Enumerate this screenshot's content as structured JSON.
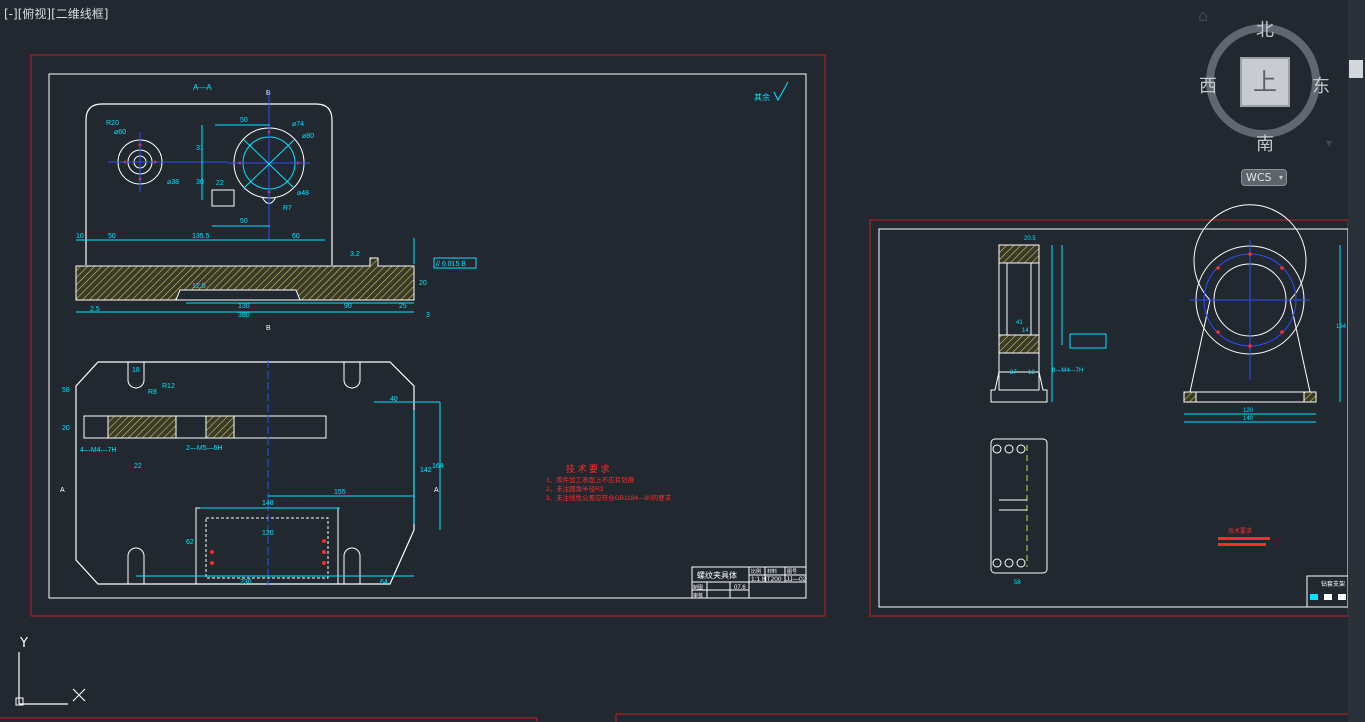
{
  "viewport_label": {
    "minus": "[-]",
    "view": "[俯视]",
    "style": "[二维线框]"
  },
  "viewcube": {
    "top_face": "上",
    "north": "北",
    "south": "南",
    "east": "东",
    "west": "西",
    "wcs": "WCS"
  },
  "ucs": {
    "y": "Y"
  },
  "colors": {
    "background": "#212830",
    "frame": "#c41e1e",
    "border": "#ffffff",
    "dim": "#00e5ff",
    "hatch": "#c9c85a",
    "text_red": "#ff2a2a",
    "center": "#2f4bff"
  },
  "sheet1": {
    "section_label": "A—A",
    "marker_b": "B",
    "marker_a": "A",
    "roughness_other": "其余",
    "dim_r20": "R20",
    "dim_phi60": "⌀60",
    "dim_phi38": "⌀38",
    "dim_50_top": "50",
    "dim_phi74": "⌀74",
    "dim_phi80": "⌀80",
    "dim_phi48": "⌀48",
    "dim_r7": "R7",
    "dim_31": "31",
    "dim_30": "30",
    "dim_22": "22",
    "dim_50_mid": "50",
    "dim_10": "10",
    "dim_50_left": "50",
    "dim_135": "135.5",
    "dim_60": "60",
    "dim_12_5": "12.5",
    "dim_130": "130",
    "dim_90": "90",
    "dim_25": "25",
    "dim_380": "380",
    "dim_3": "3",
    "dim_2_5": "2.5",
    "dim_20": "20",
    "roughness_32": "3.2",
    "tolerance": "// 0.015 B",
    "dim_58": "58",
    "dim_18": "18",
    "dim_r12": "R12",
    "dim_r8": "R8",
    "dim_40": "40",
    "dim_20_left": "20",
    "thread_m4": "4—M4—7H",
    "thread_m5": "2—M5—6H",
    "dim_22_b": "22",
    "dim_142": "142",
    "dim_164": "164",
    "dim_155": "155",
    "dim_148": "148",
    "dim_120": "120",
    "dim_62": "62",
    "dim_230": "230",
    "dim_64": "64",
    "tech_title": "技 术 要 求",
    "tech_1": "1、零件加工表面上不应有划痕",
    "tech_2": "2、未注圆角半径R3",
    "tech_3": "3、未注线性公差应符合GB1184—80的要求",
    "title_name": "螺纹夹具体",
    "title_scale": "比例",
    "title_material": "材料",
    "title_number": "图号",
    "title_scale_val": "1:1",
    "title_material_val": "HT200",
    "title_number_val": "JJ—02",
    "title_weight": "07.6",
    "title_draw": "制图",
    "title_check": "审核"
  },
  "sheet2": {
    "dim_20_5": "20.5",
    "dim_41": "41",
    "dim_14": "14",
    "dim_37": "37",
    "dim_12": "12",
    "dim_m4": "8—M4—7H",
    "dim_184": "184",
    "dim_120": "120",
    "dim_140": "140",
    "dim_58": "58",
    "tech_title": "技术要求",
    "title_name": "钻套支架"
  }
}
